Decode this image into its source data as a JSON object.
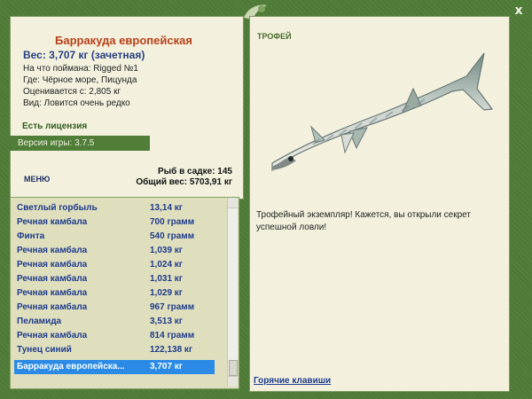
{
  "header": {
    "close_label": "x"
  },
  "fish": {
    "name": "Барракуда европейская",
    "weight_line": "Вес: 3,707 кг (зачетная)",
    "bait_line": "На что поймана: Rigged №1",
    "place_line": "Где: Чёрное море, Пицунда",
    "value_line": "Оценивается с: 2,805 кг",
    "species_line": "Вид: Ловится очень редко"
  },
  "license": {
    "label": "Есть лицензия"
  },
  "version": {
    "label": "Версия игры: 3.7.5"
  },
  "menu": {
    "title": "МЕНЮ"
  },
  "trophy": {
    "title": "ТРОФЕЙ",
    "comment": "Трофейный экземпляр! Кажется, вы открыли секрет успешной ловли!",
    "hotkeys_link": "Горячие клавиши"
  },
  "stats": {
    "in_cage": "Рыб в садке: 145",
    "total_weight": "Общий вес: 5703,91 кг"
  },
  "list": [
    {
      "name": "Светлый горбыль",
      "weight": "13,14 кг"
    },
    {
      "name": "Речная камбала",
      "weight": "700 грамм"
    },
    {
      "name": "Финта",
      "weight": "540 грамм"
    },
    {
      "name": "Речная камбала",
      "weight": "1,039 кг"
    },
    {
      "name": "Речная камбала",
      "weight": "1,024 кг"
    },
    {
      "name": "Речная камбала",
      "weight": "1,031 кг"
    },
    {
      "name": "Речная камбала",
      "weight": "1,029 кг"
    },
    {
      "name": "Речная камбала",
      "weight": "967 грамм"
    },
    {
      "name": "Пеламида",
      "weight": "3,513 кг"
    },
    {
      "name": "Речная камбала",
      "weight": "814 грамм"
    },
    {
      "name": "Тунец синий",
      "weight": "122,138 кг"
    },
    {
      "name": "Барракуда европейска...",
      "weight": "3,707 кг",
      "selected": true
    }
  ],
  "colors": {
    "frame": "#4f7c37",
    "panel": "#f3f1dd",
    "list_bg": "#dfdfbe",
    "selection": "#2a8ae5",
    "name_color": "#b8401a",
    "link_color": "#1f3c8f"
  },
  "icons": {
    "close": "close-icon",
    "logo": "fishing-logo-icon"
  }
}
